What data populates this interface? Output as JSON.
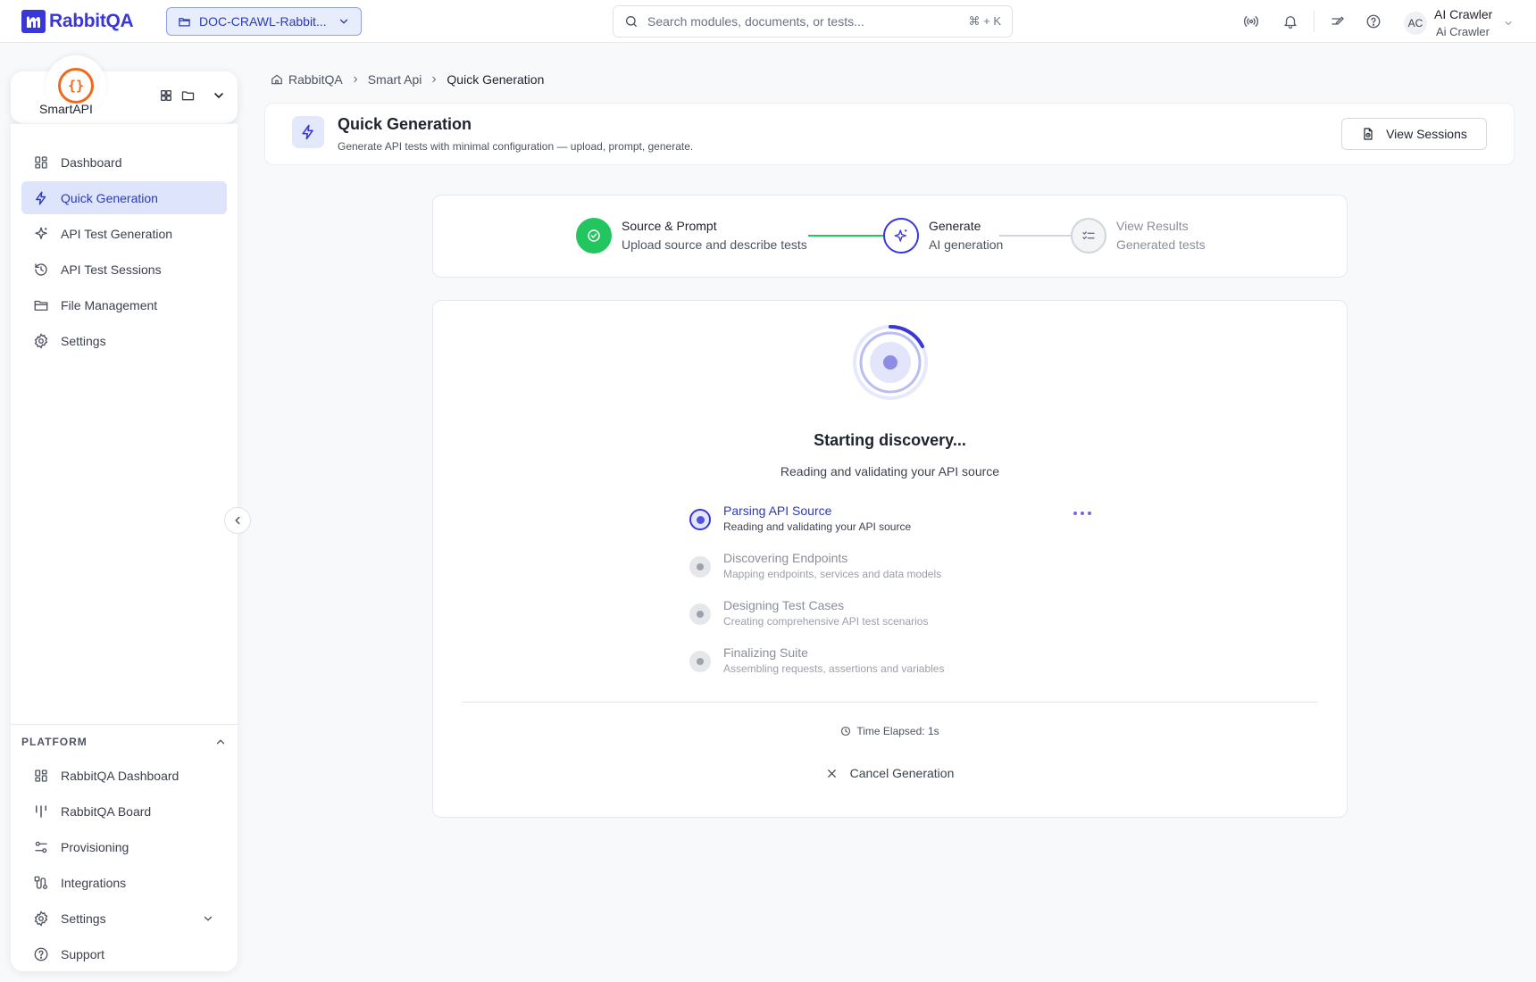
{
  "app": {
    "name": "RabbitQA"
  },
  "project_selector": {
    "label": "DOC-CRAWL-Rabbit..."
  },
  "search": {
    "placeholder": "Search modules, documents, or tests...",
    "shortcut": "⌘ + K"
  },
  "user": {
    "initials": "AC",
    "name": "AI Crawler",
    "subtitle": "Ai Crawler"
  },
  "module": {
    "name": "SmartAPI",
    "icon": "{}"
  },
  "sidebar": {
    "items": [
      {
        "label": "Dashboard",
        "icon": "dashboard-icon"
      },
      {
        "label": "Quick Generation",
        "icon": "lightning-icon",
        "active": true
      },
      {
        "label": "API Test Generation",
        "icon": "sparkles-icon"
      },
      {
        "label": "API Test Sessions",
        "icon": "history-icon"
      },
      {
        "label": "File Management",
        "icon": "folder-icon"
      },
      {
        "label": "Settings",
        "icon": "gear-icon"
      }
    ],
    "platform": {
      "heading": "PLATFORM",
      "items": [
        {
          "label": "RabbitQA Dashboard",
          "icon": "dashboard-icon"
        },
        {
          "label": "RabbitQA Board",
          "icon": "board-icon"
        },
        {
          "label": "Provisioning",
          "icon": "sliders-icon"
        },
        {
          "label": "Integrations",
          "icon": "integrations-icon"
        },
        {
          "label": "Settings",
          "icon": "gear-icon"
        },
        {
          "label": "Support",
          "icon": "help-icon"
        }
      ]
    }
  },
  "breadcrumb": [
    "RabbitQA",
    "Smart Api",
    "Quick Generation"
  ],
  "header": {
    "title": "Quick Generation",
    "subtitle": "Generate API tests with minimal configuration — upload, prompt, generate.",
    "view_sessions_label": "View Sessions"
  },
  "stepper": {
    "steps": [
      {
        "title": "Source & Prompt",
        "subtitle": "Upload source and describe tests",
        "state": "complete"
      },
      {
        "title": "Generate",
        "subtitle": "AI generation",
        "state": "active"
      },
      {
        "title": "View Results",
        "subtitle": "Generated tests",
        "state": "pending"
      }
    ]
  },
  "generation": {
    "title": "Starting discovery...",
    "subtitle": "Reading and validating your API source",
    "phases": [
      {
        "title": "Parsing API Source",
        "desc": "Reading and validating your API source",
        "state": "active"
      },
      {
        "title": "Discovering Endpoints",
        "desc": "Mapping endpoints, services and data models",
        "state": "pending"
      },
      {
        "title": "Designing Test Cases",
        "desc": "Creating comprehensive API test scenarios",
        "state": "pending"
      },
      {
        "title": "Finalizing Suite",
        "desc": "Assembling requests, assertions and variables",
        "state": "pending"
      }
    ],
    "elapsed": "Time Elapsed: 1s",
    "cancel_label": "Cancel Generation"
  },
  "colors": {
    "brand": "#3a37d9",
    "success": "#22c55e",
    "module_accent": "#f06a1d",
    "active_bg": "#dde4fb"
  }
}
